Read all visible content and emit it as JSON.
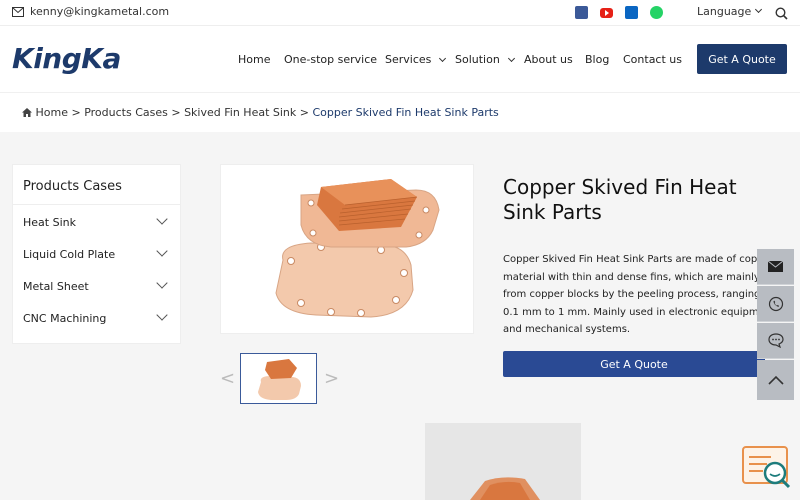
{
  "topbar": {
    "email": "kenny@kingkametal.com",
    "language": "Language",
    "social": [
      "facebook-icon",
      "youtube-icon",
      "linkedin-icon",
      "whatsapp-icon"
    ]
  },
  "header": {
    "logo": "KingKa",
    "nav": [
      {
        "label": "Home"
      },
      {
        "label": "One-stop service"
      },
      {
        "label": "Services"
      },
      {
        "label": "Solution"
      },
      {
        "label": "About us"
      },
      {
        "label": "Blog"
      },
      {
        "label": "Contact us"
      }
    ],
    "quote_button": "Get A Quote"
  },
  "breadcrumb": {
    "home": "Home",
    "sep": ">",
    "products": "Products Cases",
    "category": "Skived Fin Heat Sink",
    "current": "Copper Skived Fin Heat Sink Parts"
  },
  "sidebar": {
    "title": "Products Cases",
    "items": [
      {
        "label": "Heat Sink"
      },
      {
        "label": "Liquid Cold Plate"
      },
      {
        "label": "Metal Sheet"
      },
      {
        "label": "CNC Machining"
      }
    ]
  },
  "product": {
    "title": "Copper Skived Fin Heat Sink Parts",
    "description": "Copper Skived Fin Heat Sink Parts are made of cop\nmaterial with thin and dense fins, which are mainly\nfrom copper blocks by the peeling process, ranging\n0.1 mm to 1 mm. Mainly used in electronic equipm\nand mechanical systems.",
    "prev_arrow": "<",
    "next_arrow": ">",
    "quote_button": "Get A Quote"
  },
  "colors": {
    "brand": "#1d3a6b",
    "button": "#2a4a94",
    "copper": "#e0905e"
  }
}
